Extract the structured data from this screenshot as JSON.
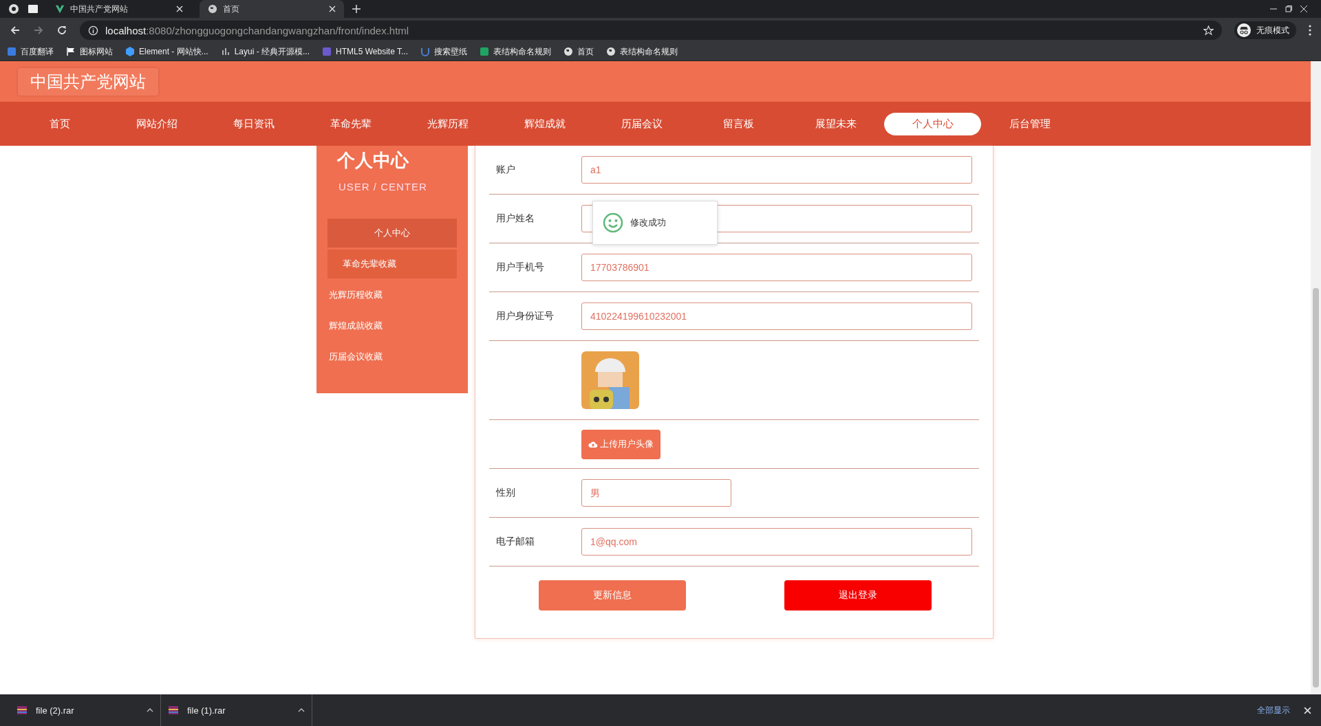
{
  "browser": {
    "tabs": [
      {
        "title": "中国共产党网站",
        "selected": false
      },
      {
        "title": "首页",
        "selected": true
      }
    ],
    "url": {
      "host": "localhost",
      "path": ":8080/zhongguogongchandangwangzhan/front/index.html"
    },
    "profile": "无痕模式",
    "bookmarks": [
      "百度翻译",
      "图标网站",
      "Element - 网站快...",
      "Layui - 经典开源模...",
      "HTML5 Website T...",
      "搜索壁纸",
      "表结构命名规则",
      "首页",
      "表结构命名规则"
    ]
  },
  "site": {
    "logo": "中国共产党网站",
    "nav": [
      {
        "label": "首页",
        "selected": false
      },
      {
        "label": "网站介绍",
        "selected": false
      },
      {
        "label": "每日资讯",
        "selected": false
      },
      {
        "label": "革命先辈",
        "selected": false
      },
      {
        "label": "光辉历程",
        "selected": false
      },
      {
        "label": "辉煌成就",
        "selected": false
      },
      {
        "label": "历届会议",
        "selected": false
      },
      {
        "label": "留言板",
        "selected": false
      },
      {
        "label": "展望未来",
        "selected": false
      },
      {
        "label": "个人中心",
        "selected": true
      },
      {
        "label": "后台管理",
        "selected": false
      }
    ]
  },
  "sidebar": {
    "title": "个人中心",
    "subtitle": "USER / CENTER",
    "items": [
      {
        "label": "个人中心",
        "selected": true,
        "hovered": false
      },
      {
        "label": "革命先辈收藏",
        "selected": false,
        "hovered": true
      },
      {
        "label": "光辉历程收藏",
        "selected": false,
        "hovered": false
      },
      {
        "label": "辉煌成就收藏",
        "selected": false,
        "hovered": false
      },
      {
        "label": "历届会议收藏",
        "selected": false,
        "hovered": false
      }
    ]
  },
  "form": {
    "rows": [
      {
        "kind": "text",
        "label": "账户",
        "value": "a1"
      },
      {
        "kind": "text",
        "label": "用户姓名"
      },
      {
        "kind": "text",
        "label": "用户手机号",
        "value": "17703786901"
      },
      {
        "kind": "text",
        "label": "用户身份证号",
        "value": "410224199610232001"
      },
      {
        "kind": "avatar"
      },
      {
        "kind": "upload",
        "button": "上传用户头像"
      },
      {
        "kind": "select",
        "label": "性别",
        "value": "男"
      },
      {
        "kind": "text",
        "label": "电子邮箱",
        "value": "1@qq.com"
      }
    ],
    "buttons": [
      {
        "kind": "primary",
        "label": "更新信息"
      },
      {
        "kind": "danger",
        "label": "退出登录"
      }
    ]
  },
  "toast": {
    "text": "修改成功"
  },
  "downloads": {
    "files": [
      "file (2).rar",
      "file (1).rar"
    ],
    "show_all": "全部显示"
  }
}
